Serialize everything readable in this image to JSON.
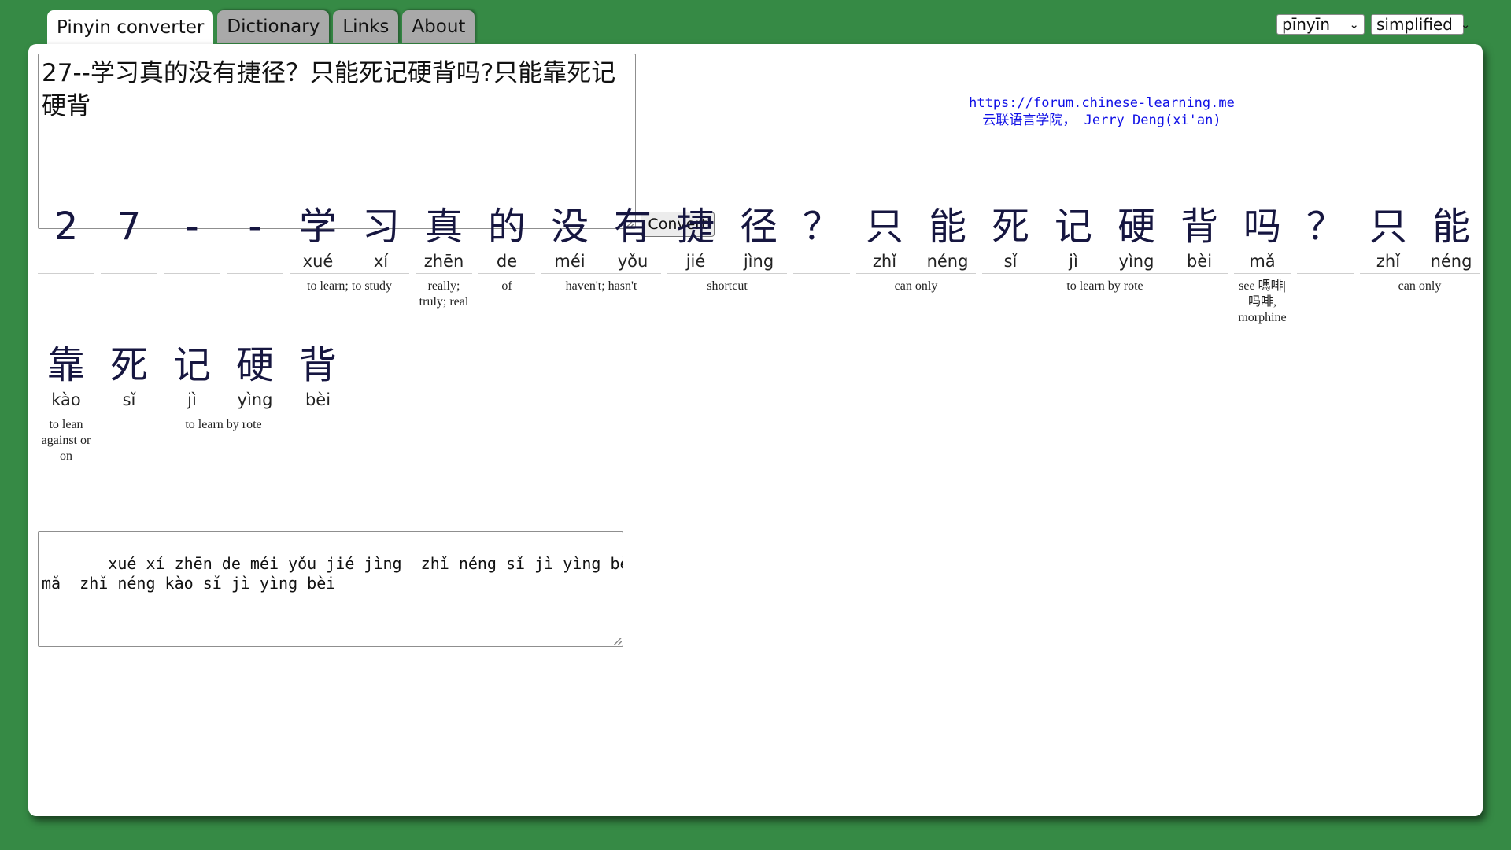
{
  "tabs": [
    {
      "label": "Pinyin converter",
      "active": true
    },
    {
      "label": "Dictionary",
      "active": false
    },
    {
      "label": "Links",
      "active": false
    },
    {
      "label": "About",
      "active": false
    }
  ],
  "selects": {
    "romanization": "pīnyīn",
    "script": "simplified"
  },
  "input_text": "27--学习真的没有捷径？只能死记硬背吗?只能靠死记硬背",
  "convert_label": "Convert",
  "credit": {
    "url": "https://forum.chinese-learning.me",
    "name": "云联语言学院， Jerry Deng(xi'an)"
  },
  "rows": [
    {
      "units": [
        {
          "chars": [
            {
              "c": "2",
              "py": ""
            }
          ],
          "gloss": ""
        },
        {
          "chars": [
            {
              "c": "7",
              "py": ""
            }
          ],
          "gloss": ""
        },
        {
          "chars": [
            {
              "c": "-",
              "py": ""
            }
          ],
          "gloss": ""
        },
        {
          "chars": [
            {
              "c": "-",
              "py": ""
            }
          ],
          "gloss": ""
        },
        {
          "chars": [
            {
              "c": "学",
              "py": "xué"
            },
            {
              "c": "习",
              "py": "xí"
            }
          ],
          "gloss": "to learn; to study"
        },
        {
          "chars": [
            {
              "c": "真",
              "py": "zhēn"
            }
          ],
          "gloss": "really; truly; real"
        },
        {
          "chars": [
            {
              "c": "的",
              "py": "de"
            }
          ],
          "gloss": "of"
        },
        {
          "chars": [
            {
              "c": "没",
              "py": "méi"
            },
            {
              "c": "有",
              "py": "yǒu"
            }
          ],
          "gloss": "haven't; hasn't"
        },
        {
          "chars": [
            {
              "c": "捷",
              "py": "jié"
            },
            {
              "c": "径",
              "py": "jìng"
            }
          ],
          "gloss": "shortcut"
        },
        {
          "chars": [
            {
              "c": "？",
              "py": ""
            }
          ],
          "gloss": ""
        },
        {
          "chars": [
            {
              "c": "只",
              "py": "zhǐ"
            },
            {
              "c": "能",
              "py": "néng"
            }
          ],
          "gloss": "can only"
        },
        {
          "chars": [
            {
              "c": "死",
              "py": "sǐ"
            },
            {
              "c": "记",
              "py": "jì"
            },
            {
              "c": "硬",
              "py": "yìng"
            },
            {
              "c": "背",
              "py": "bèi"
            }
          ],
          "gloss": "to learn by rote"
        },
        {
          "chars": [
            {
              "c": "吗",
              "py": "mǎ"
            }
          ],
          "gloss": "see 嗎啡|吗啡, morphine"
        },
        {
          "chars": [
            {
              "c": "？",
              "py": ""
            }
          ],
          "gloss": ""
        },
        {
          "chars": [
            {
              "c": "只",
              "py": "zhǐ"
            },
            {
              "c": "能",
              "py": "néng"
            }
          ],
          "gloss": "can only"
        }
      ]
    },
    {
      "units": [
        {
          "chars": [
            {
              "c": "靠",
              "py": "kào"
            }
          ],
          "gloss": "to lean against or on"
        },
        {
          "chars": [
            {
              "c": "死",
              "py": "sǐ"
            },
            {
              "c": "记",
              "py": "jì"
            },
            {
              "c": "硬",
              "py": "yìng"
            },
            {
              "c": "背",
              "py": "bèi"
            }
          ],
          "gloss": "to learn by rote"
        }
      ]
    }
  ],
  "output_text": "   xué xí zhēn de méi yǒu jié jìng  zhǐ néng sǐ jì yìng bèi\nmǎ  zhǐ néng kào sǐ jì yìng bèi"
}
